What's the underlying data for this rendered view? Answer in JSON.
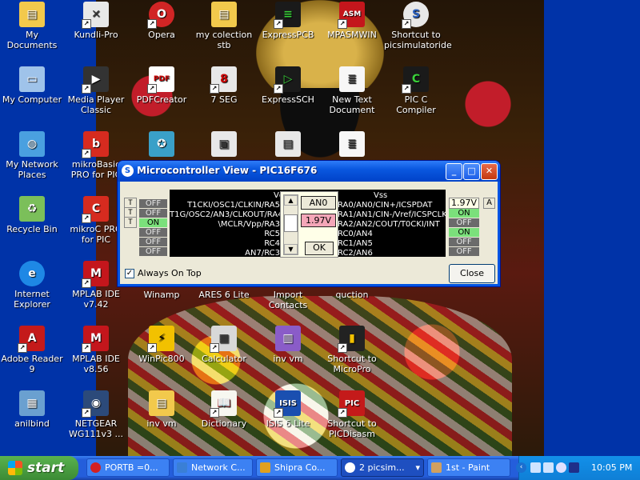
{
  "desktop": {
    "icons": [
      {
        "label": "My Documents"
      },
      {
        "label": "Kundli-Pro"
      },
      {
        "label": "Opera"
      },
      {
        "label": "my colection stb"
      },
      {
        "label": "ExpressPCB"
      },
      {
        "label": "MPASMWIN"
      },
      {
        "label": "Shortcut to picsimulatoride"
      },
      {
        "label": "My Computer"
      },
      {
        "label": "Media Player Classic"
      },
      {
        "label": "PDFCreator"
      },
      {
        "label": "7 SEG"
      },
      {
        "label": "ExpressSCH"
      },
      {
        "label": "New Text Document"
      },
      {
        "label": "PIC C Compiler"
      },
      {
        "label": "My Network Places"
      },
      {
        "label": "mikroBasic PRO for PIC"
      },
      {
        "label": "Recycle Bin"
      },
      {
        "label": "mikroC PRO for PIC"
      },
      {
        "label": "Internet Explorer"
      },
      {
        "label": "MPLAB IDE v7.42"
      },
      {
        "label": "Winamp"
      },
      {
        "label": "ARES 6 Lite"
      },
      {
        "label": "Import Contacts"
      },
      {
        "label": "quction"
      },
      {
        "label": "Adobe Reader 9"
      },
      {
        "label": "MPLAB IDE v8.56"
      },
      {
        "label": "WinPic800"
      },
      {
        "label": "Calculator"
      },
      {
        "label": "inv vm"
      },
      {
        "label": "Shortcut to MicroPro"
      },
      {
        "label": "anilbind"
      },
      {
        "label": "NETGEAR WG111v3 ..."
      },
      {
        "label": "inv vm"
      },
      {
        "label": "Dictionary"
      },
      {
        "label": "ISIS 6 Lite"
      },
      {
        "label": "Shortcut to PICDisasm"
      }
    ]
  },
  "window": {
    "title": "Microcontroller View - PIC16F676",
    "left_tbuttons": [
      "T",
      "T",
      "T"
    ],
    "left_states": [
      "OFF",
      "OFF",
      "ON",
      "OFF",
      "OFF",
      "OFF",
      "OFF"
    ],
    "pins_left": [
      "T1CKI/OSC1/CLKIN/RA5",
      "T1G/OSC2/AN3/CLKOUT/RA4",
      "\\MCLR/Vpp/RA3",
      "RC5",
      "RC4",
      "AN7/RC3"
    ],
    "pins_right": [
      "RA0/AN0/CIN+/ICSPDAT",
      "RA1/AN1/CIN-/Vref/ICSPCLK",
      "RA2/AN2/COUT/T0CKI/INT",
      "RC0/AN4",
      "RC1/AN5",
      "RC2/AN6"
    ],
    "vdd_label": "Vdd",
    "vss_label": "Vss",
    "popup": {
      "channel": "AN0",
      "voltage": "1.97V",
      "ok": "OK"
    },
    "right_voltage": "1.97V",
    "right_a_button": "A",
    "right_states": [
      "ON",
      "OFF",
      "ON",
      "OFF",
      "OFF"
    ],
    "always_on_top": "Always On Top",
    "close_button": "Close"
  },
  "taskbar": {
    "start": "start",
    "tasks": [
      {
        "label": "PORTB =0...",
        "color": "#d42020"
      },
      {
        "label": "Network C...",
        "color": "#3a7fd6"
      },
      {
        "label": "Shipra Co...",
        "color": "#e0a020"
      },
      {
        "label": "2 picsim...",
        "color": "#2a60c0"
      },
      {
        "label": "1st - Paint",
        "color": "#d0a060"
      }
    ],
    "clock": "10:05 PM"
  }
}
